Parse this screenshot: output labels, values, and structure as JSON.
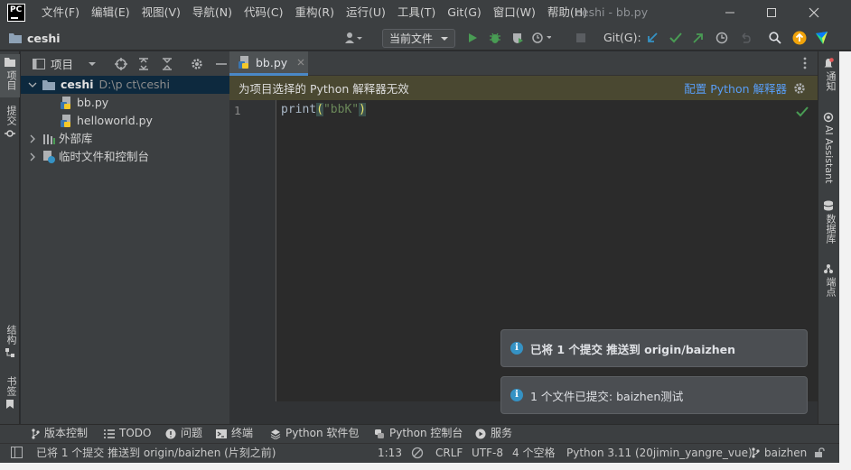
{
  "app": {
    "logo_text": "PC",
    "window_title": "ceshi - bb.py",
    "colors": {
      "panel_bg": "#3c3f41",
      "editor_bg": "#2b2b2b",
      "selection": "#0d293e",
      "accent_blue": "#4a88c7",
      "run_green": "#499c54",
      "banner_bg": "#4a4831",
      "string": "#6a8759",
      "notif_info": "#3592c4"
    }
  },
  "menu": [
    "文件(F)",
    "编辑(E)",
    "视图(V)",
    "导航(N)",
    "代码(C)",
    "重构(R)",
    "运行(U)",
    "工具(T)",
    "Git(G)",
    "窗口(W)",
    "帮助(H)"
  ],
  "window_controls": [
    "minimize-icon",
    "maximize-icon",
    "close-icon"
  ],
  "navbar": {
    "project_name": "ceshi",
    "run_config": "当前文件",
    "git_label": "Git(G):"
  },
  "left_stripe": {
    "top": [
      "项目",
      "提交"
    ],
    "bottom": [
      "结构",
      "书签"
    ]
  },
  "right_stripe": [
    "通知",
    "AI Assistant",
    "数据库",
    "端点"
  ],
  "project_panel": {
    "title": "项目",
    "root": {
      "name": "ceshi",
      "path": "D:\\p   ct\\ceshi"
    },
    "files": [
      "bb.py",
      "helloworld.py"
    ],
    "external": "外部库",
    "scratches": "临时文件和控制台"
  },
  "editor": {
    "tab": "bb.py",
    "banner_text": "为项目选择的 Python 解释器无效",
    "banner_link": "配置 Python 解释器",
    "line_number": "1",
    "code": {
      "func": "print",
      "open": "(",
      "string": "\"bbK\"",
      "close": ")"
    }
  },
  "notifications": [
    {
      "text": "已将 1 个提交 推送到 origin/baizhen",
      "bold": true
    },
    {
      "text": "1 个文件已提交: baizhen测试",
      "bold": false
    }
  ],
  "bottom_tools": [
    "版本控制",
    "TODO",
    "问题",
    "终端",
    "Python 软件包",
    "Python 控制台",
    "服务"
  ],
  "status": {
    "message": "已将 1 个提交 推送到 origin/baizhen (片刻之前)",
    "position": "1:13",
    "line_sep": "CRLF",
    "encoding": "UTF-8",
    "indent": "4 个空格",
    "interpreter": "Python 3.11 (20jimin_yangre_vue)",
    "branch": "baizhen"
  }
}
